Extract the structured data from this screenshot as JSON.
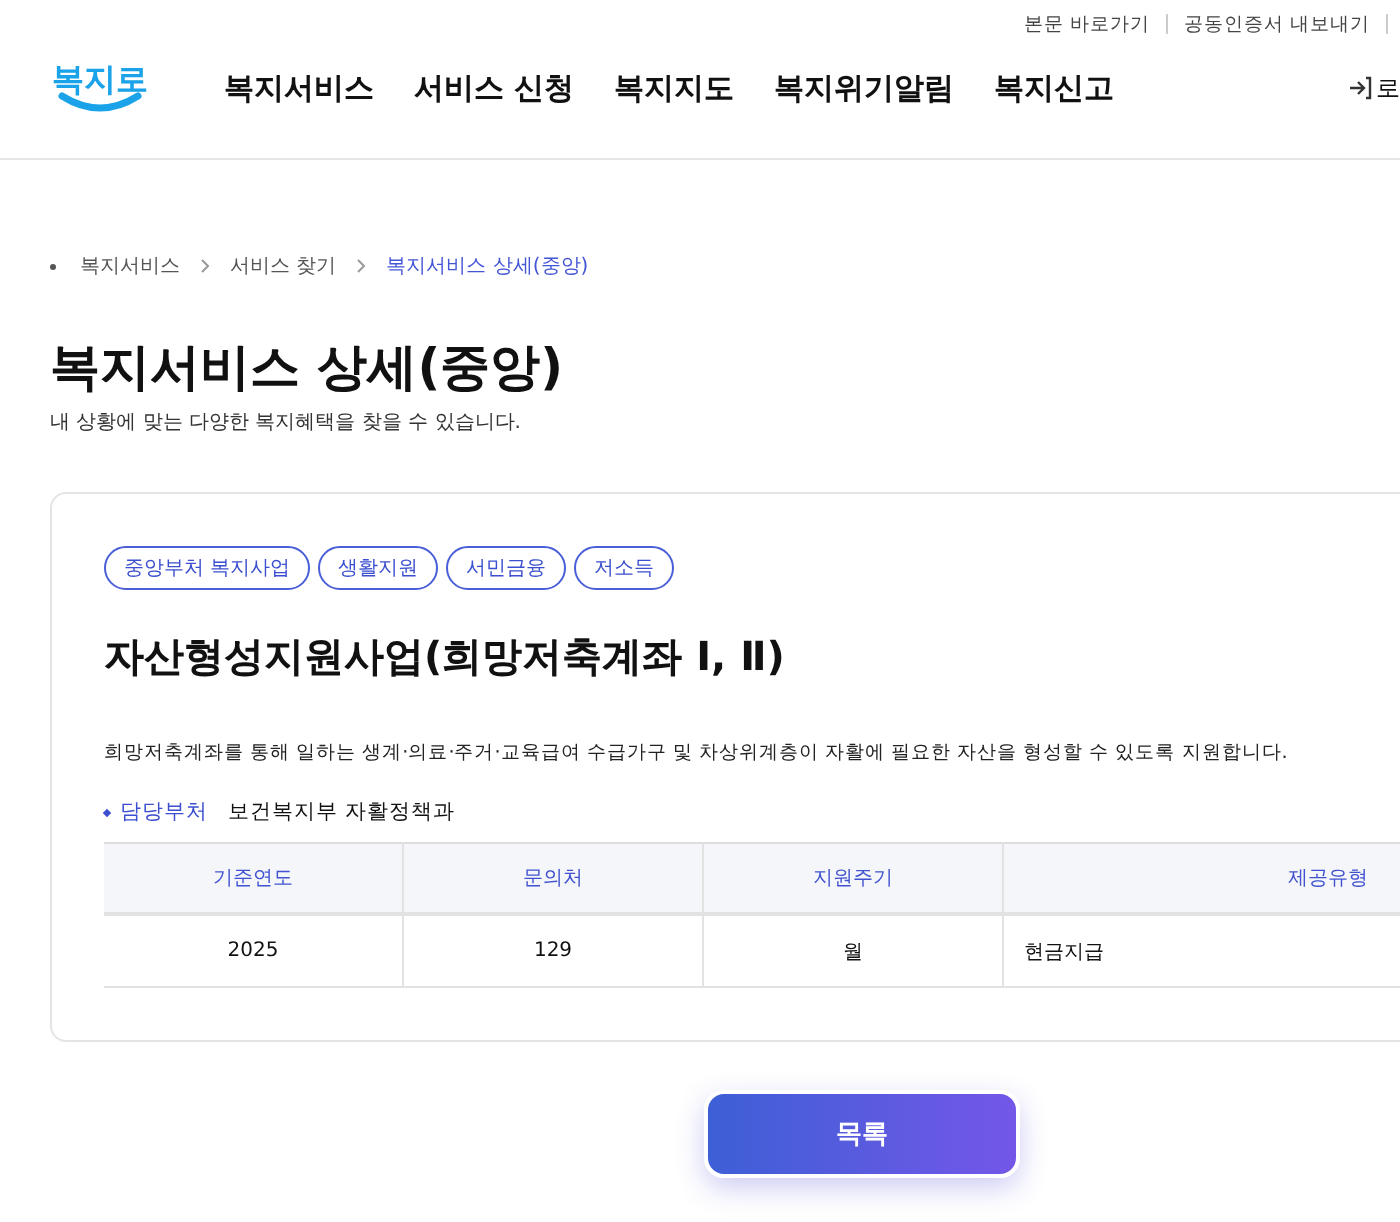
{
  "header": {
    "utility_links": [
      "본문 바로가기",
      "공동인증서 내보내기"
    ],
    "logo": "복지로",
    "nav": [
      "복지서비스",
      "서비스 신청",
      "복지지도",
      "복지위기알림",
      "복지신고"
    ],
    "login": "로"
  },
  "breadcrumb": [
    "복지서비스",
    "서비스 찾기",
    "복지서비스 상세(중앙)"
  ],
  "page_title": "복지서비스 상세(중앙)",
  "page_subtitle": "내 상황에 맞는 다양한 복지혜택을 찾을 수 있습니다.",
  "service": {
    "tags": [
      "중앙부처 복지사업",
      "생활지원",
      "서민금융",
      "저소득"
    ],
    "title": "자산형성지원사업(희망저축계좌 Ⅰ, Ⅱ)",
    "description": "희망저축계좌를 통해 일하는 생계·의료·주거·교육급여 수급가구 및 차상위계층이 자활에 필요한 자산을 형성할 수 있도록 지원합니다.",
    "department": {
      "label": "담당부처",
      "value": "보건복지부 자활정책과"
    },
    "table": {
      "columns": [
        "기준연도",
        "문의처",
        "지원주기",
        "제공유형"
      ],
      "rows": [
        [
          "2025",
          "129",
          "월",
          "현금지급"
        ]
      ]
    }
  },
  "list_button": "목록"
}
